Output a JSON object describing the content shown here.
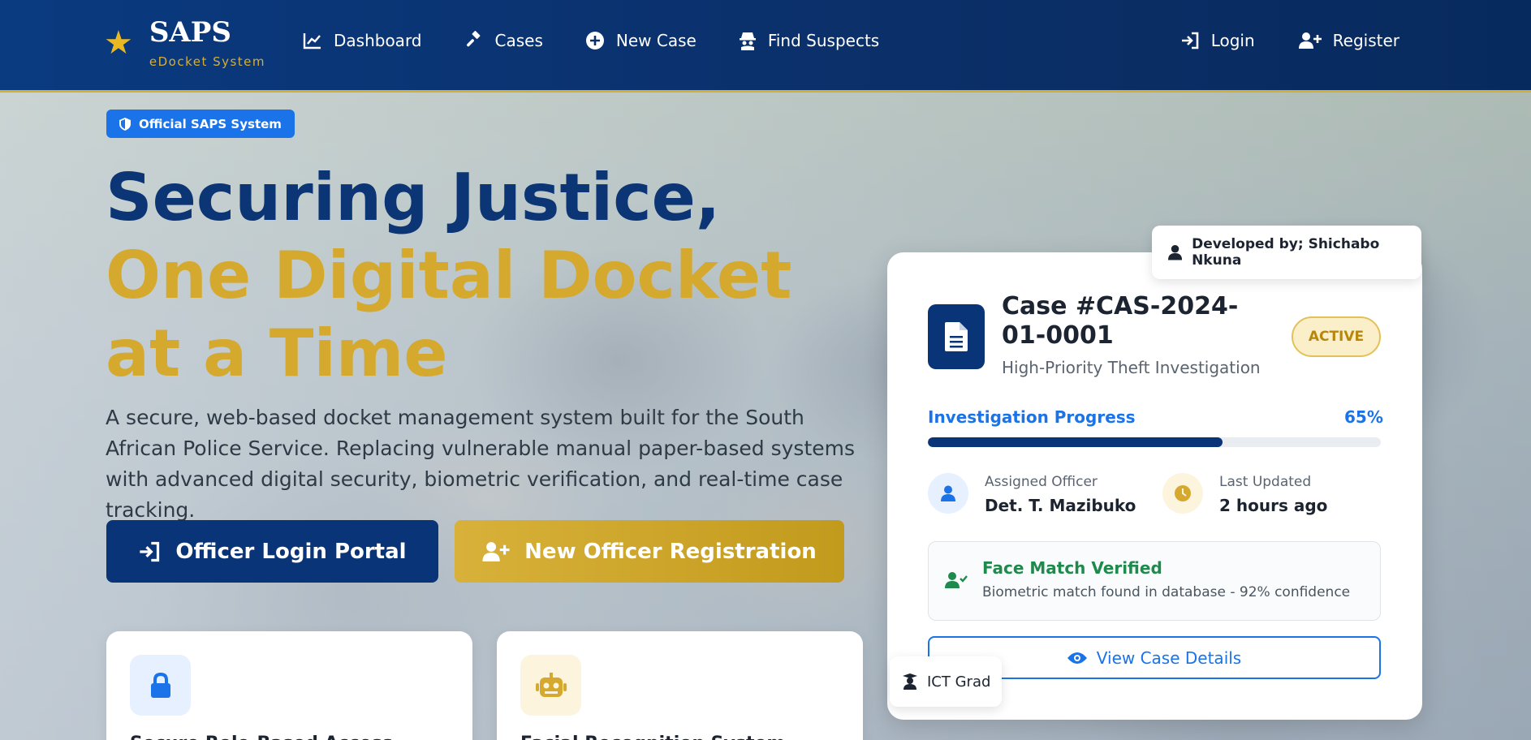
{
  "nav": {
    "brand_title": "SAPS",
    "brand_sub": "eDocket System",
    "links": [
      {
        "label": "Dashboard",
        "icon": "chart-line-icon"
      },
      {
        "label": "Cases",
        "icon": "gavel-icon"
      },
      {
        "label": "New Case",
        "icon": "plus-circle-icon"
      },
      {
        "label": "Find Suspects",
        "icon": "detective-icon"
      }
    ],
    "login_label": "Login",
    "register_label": "Register"
  },
  "hero": {
    "badge": "Official SAPS System",
    "title_line1": "Securing Justice,",
    "title_line2": "One Digital Docket at a Time",
    "description": "A secure, web-based docket management system built for the South African Police Service. Replacing vulnerable manual paper-based systems with advanced digital security, biometric verification, and real-time case tracking.",
    "login_button": "Officer Login Portal",
    "register_button": "New Officer Registration"
  },
  "features": [
    {
      "title": "Secure Role-Based Access",
      "icon": "lock-icon"
    },
    {
      "title": "Facial Recognition System",
      "icon": "robot-icon"
    }
  ],
  "case_card": {
    "developer_tag": "Developed by; Shichabo Nkuna",
    "case_number": "Case #CAS-2024-01-0001",
    "case_subtitle": "High-Priority Theft Investigation",
    "status": "ACTIVE",
    "progress_label": "Investigation Progress",
    "progress_value": "65%",
    "progress_fraction": 0.65,
    "officer_label": "Assigned Officer",
    "officer_value": "Det. T. Mazibuko",
    "updated_label": "Last Updated",
    "updated_value": "2 hours ago",
    "verify_title": "Face Match Verified",
    "verify_text": "Biometric match found in database - 92% confidence",
    "view_button": "View Case Details",
    "ict_tag": "ICT Grad"
  },
  "colors": {
    "navy": "#0a3478",
    "gold": "#d4a92e",
    "accent_blue": "#1a73e8",
    "success_green": "#1e8a4c"
  }
}
